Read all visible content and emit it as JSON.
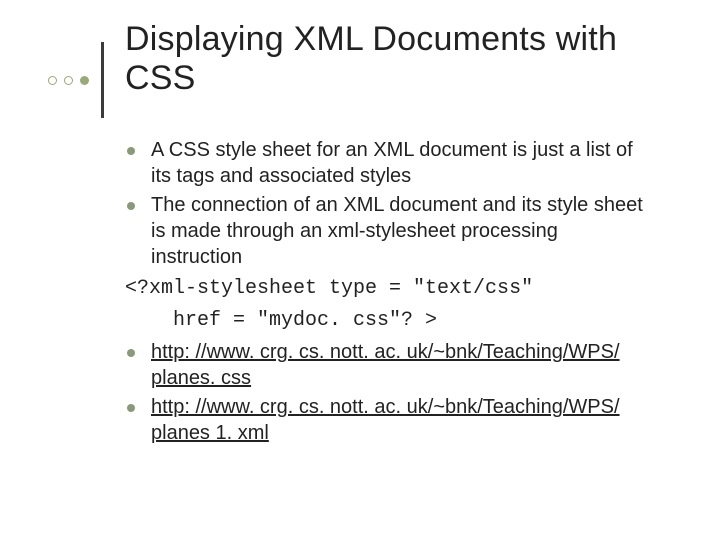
{
  "title": "Displaying XML Documents with CSS",
  "bullets_top": [
    "A CSS style sheet for an XML document is just a list of its tags and associated styles",
    "The connection of an XML document and its style sheet is made through an xml-stylesheet processing instruction"
  ],
  "code_line1": "<?xml-stylesheet type = \"text/css\"",
  "code_line2": "href = \"mydoc. css\"? >",
  "bullets_links": [
    "http: //www. crg. cs. nott. ac. uk/~bnk/Teaching/WPS/ planes. css",
    "http: //www. crg. cs. nott. ac. uk/~bnk/Teaching/WPS/ planes 1. xml"
  ]
}
